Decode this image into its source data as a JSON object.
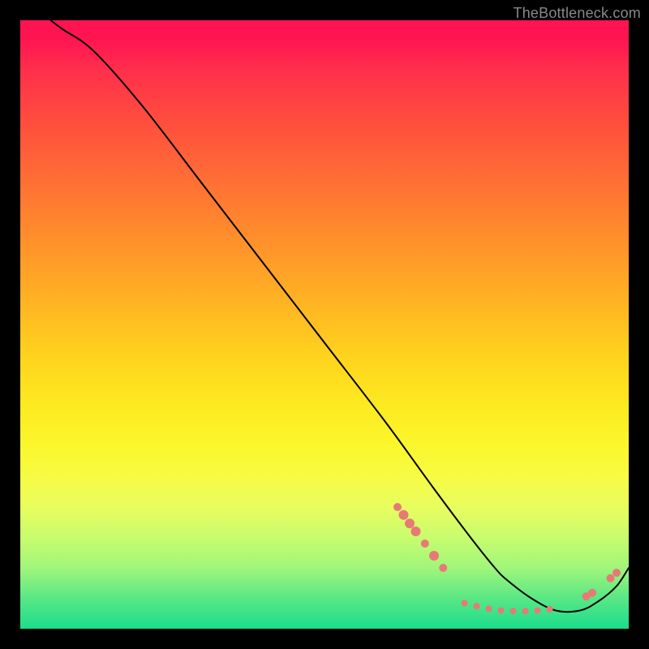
{
  "attribution": "TheBottleneck.com",
  "chart_data": {
    "type": "line",
    "title": "",
    "xlabel": "",
    "ylabel": "",
    "xlim": [
      0,
      100
    ],
    "ylim": [
      0,
      100
    ],
    "series": [
      {
        "name": "curve",
        "x": [
          5,
          7,
          12,
          20,
          30,
          40,
          50,
          60,
          68,
          74,
          78,
          80,
          84,
          88,
          92,
          95,
          98,
          100
        ],
        "y": [
          100,
          98.5,
          95,
          86,
          73,
          60,
          47,
          34,
          23,
          15,
          10,
          8,
          5,
          3,
          3,
          4.5,
          7,
          10
        ]
      }
    ],
    "markers": [
      {
        "x": 62,
        "y": 20.0,
        "r": 5
      },
      {
        "x": 63,
        "y": 18.7,
        "r": 6
      },
      {
        "x": 64,
        "y": 17.3,
        "r": 6
      },
      {
        "x": 65,
        "y": 16.0,
        "r": 6
      },
      {
        "x": 66.5,
        "y": 14.0,
        "r": 5
      },
      {
        "x": 68,
        "y": 12.0,
        "r": 6
      },
      {
        "x": 69.5,
        "y": 10.0,
        "r": 5
      },
      {
        "x": 73,
        "y": 4.2,
        "r": 4
      },
      {
        "x": 75,
        "y": 3.7,
        "r": 4
      },
      {
        "x": 77,
        "y": 3.3,
        "r": 4
      },
      {
        "x": 79,
        "y": 3.0,
        "r": 4
      },
      {
        "x": 81,
        "y": 2.9,
        "r": 4
      },
      {
        "x": 83,
        "y": 2.9,
        "r": 4
      },
      {
        "x": 85,
        "y": 3.0,
        "r": 4
      },
      {
        "x": 87,
        "y": 3.2,
        "r": 4
      },
      {
        "x": 93,
        "y": 5.3,
        "r": 5
      },
      {
        "x": 94,
        "y": 5.9,
        "r": 5
      },
      {
        "x": 97,
        "y": 8.3,
        "r": 5
      },
      {
        "x": 98,
        "y": 9.2,
        "r": 5
      }
    ],
    "colors": {
      "curve": "#000000",
      "marker": "#e77a76"
    }
  }
}
